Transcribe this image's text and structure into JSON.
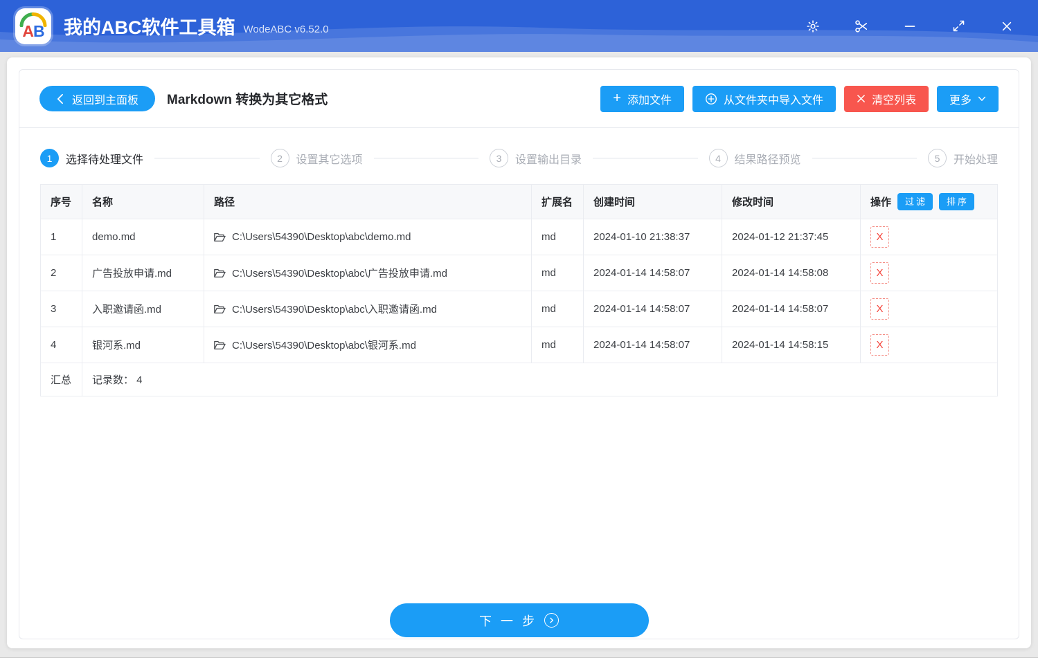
{
  "colors": {
    "titlebar_blue": "#2d62d8",
    "accent_blue": "#1b9df6",
    "danger_red": "#f8564e",
    "logo_a_red": "#e2453c",
    "logo_b_blue": "#2b6be0",
    "logo_arc_green": "#3fae4e",
    "logo_arc_gold": "#f0b400"
  },
  "titlebar": {
    "logo_a": "A",
    "logo_b": "B",
    "app_title": "我的ABC软件工具箱",
    "version": "WodeABC v6.52.0"
  },
  "toolbar": {
    "back_label": "返回到主面板",
    "page_title": "Markdown 转换为其它格式",
    "add_files_label": "添加文件",
    "import_folder_label": "从文件夹中导入文件",
    "clear_list_label": "清空列表",
    "more_label": "更多"
  },
  "steps": [
    {
      "num": "1",
      "label": "选择待处理文件"
    },
    {
      "num": "2",
      "label": "设置其它选项"
    },
    {
      "num": "3",
      "label": "设置输出目录"
    },
    {
      "num": "4",
      "label": "结果路径预览"
    },
    {
      "num": "5",
      "label": "开始处理"
    }
  ],
  "table": {
    "headers": {
      "index": "序号",
      "name": "名称",
      "path": "路径",
      "ext": "扩展名",
      "created": "创建时间",
      "modified": "修改时间",
      "action": "操作"
    },
    "filter_label": "过滤",
    "sort_label": "排序",
    "delete_label": "X",
    "rows": [
      {
        "index": "1",
        "name": "demo.md",
        "path": "C:\\Users\\54390\\Desktop\\abc\\demo.md",
        "ext": "md",
        "created": "2024-01-10 21:38:37",
        "modified": "2024-01-12 21:37:45"
      },
      {
        "index": "2",
        "name": "广告投放申请.md",
        "path": "C:\\Users\\54390\\Desktop\\abc\\广告投放申请.md",
        "ext": "md",
        "created": "2024-01-14 14:58:07",
        "modified": "2024-01-14 14:58:08"
      },
      {
        "index": "3",
        "name": "入职邀请函.md",
        "path": "C:\\Users\\54390\\Desktop\\abc\\入职邀请函.md",
        "ext": "md",
        "created": "2024-01-14 14:58:07",
        "modified": "2024-01-14 14:58:07"
      },
      {
        "index": "4",
        "name": "银河系.md",
        "path": "C:\\Users\\54390\\Desktop\\abc\\银河系.md",
        "ext": "md",
        "created": "2024-01-14 14:58:07",
        "modified": "2024-01-14 14:58:15"
      }
    ],
    "summary_label": "汇总",
    "summary_text": "记录数： 4"
  },
  "footer": {
    "next_label": "下 一 步"
  }
}
